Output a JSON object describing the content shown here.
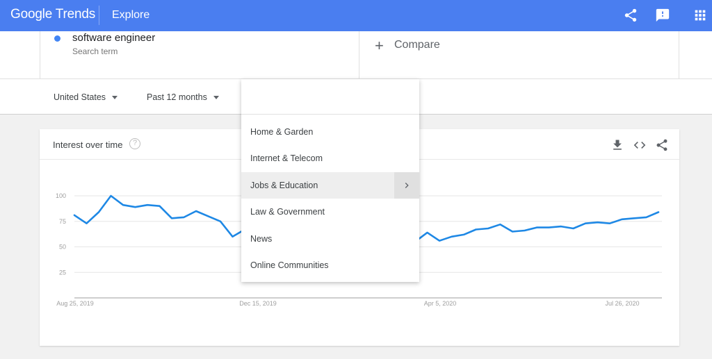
{
  "header": {
    "logo": "Google Trends",
    "nav_label": "Explore",
    "icons": [
      "share-icon",
      "feedback-icon",
      "apps-grid-icon"
    ],
    "color": "#4a7ef0"
  },
  "search_term": {
    "name": "software engineer",
    "type": "Search term",
    "color": "#4285f4"
  },
  "compare": {
    "label": "Compare"
  },
  "filters": {
    "region": "United States",
    "time_range": "Past 12 months"
  },
  "card": {
    "title": "Interest over time",
    "help": "?",
    "icons": [
      "download-icon",
      "embed-icon",
      "share-icon"
    ]
  },
  "category_dropdown": {
    "search_value": "",
    "items": [
      "Home & Garden",
      "Internet & Telecom",
      "Jobs & Education",
      "Law & Government",
      "News",
      "Online Communities"
    ],
    "active_index": 2
  },
  "chart_data": {
    "type": "line",
    "x_tick_labels": [
      "Aug 25, 2019",
      "Dec 15, 2019",
      "Apr 5, 2020",
      "Jul 26, 2020"
    ],
    "y_tick_labels": [
      "100",
      "75",
      "50",
      "25"
    ],
    "ylim": [
      0,
      100
    ],
    "grid": true,
    "series": [
      {
        "color": "#1e88e5",
        "values": [
          81,
          73,
          84,
          100,
          91,
          89,
          91,
          90,
          78,
          79,
          85,
          80,
          75,
          60,
          67,
          71,
          70,
          69,
          68,
          66,
          64,
          62,
          60,
          58,
          57,
          56,
          55,
          56,
          55,
          64,
          56,
          60,
          62,
          67,
          68,
          72,
          65,
          66,
          69,
          69,
          70,
          68,
          73,
          74,
          73,
          77,
          78,
          79,
          84
        ]
      }
    ]
  }
}
